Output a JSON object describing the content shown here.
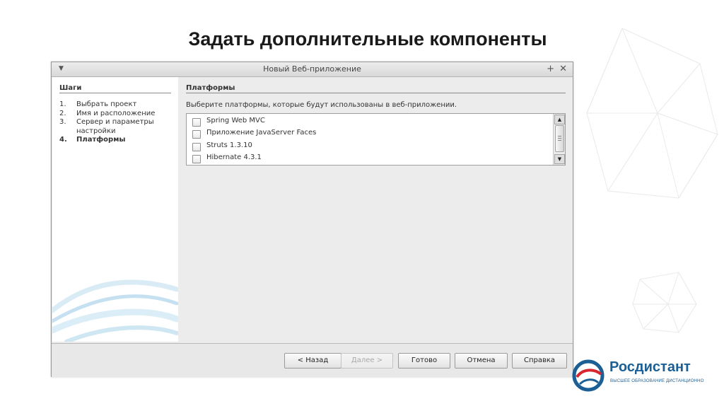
{
  "slide": {
    "title": "Задать дополнительные компоненты"
  },
  "dialog": {
    "title": "Новый Веб-приложение",
    "menu_glyph": "▼",
    "plus_glyph": "+",
    "close_glyph": "✕"
  },
  "steps": {
    "heading": "Шаги",
    "items": [
      {
        "num": "1.",
        "label": "Выбрать проект"
      },
      {
        "num": "2.",
        "label": "Имя и расположение"
      },
      {
        "num": "3.",
        "label": "Сервер и параметры настройки"
      },
      {
        "num": "4.",
        "label": "Платформы"
      }
    ],
    "current_index": 3
  },
  "content": {
    "heading": "Платформы",
    "description": "Выберите платформы, которые будут использованы в веб-приложении.",
    "frameworks": [
      {
        "label": "Spring Web MVC",
        "checked": false
      },
      {
        "label": "Приложение JavaServer Faces",
        "checked": false
      },
      {
        "label": "Struts 1.3.10",
        "checked": false
      },
      {
        "label": "Hibernate 4.3.1",
        "checked": false
      }
    ]
  },
  "buttons": {
    "back": "< Назад",
    "next": "Далее >",
    "finish": "Готово",
    "cancel": "Отмена",
    "help": "Справка"
  },
  "logo": {
    "name": "Росдистант",
    "tagline": "ВЫСШЕЕ ОБРАЗОВАНИЕ ДИСТАНЦИОННО",
    "colors": {
      "blue": "#1b5f95",
      "red": "#d7262e"
    }
  }
}
